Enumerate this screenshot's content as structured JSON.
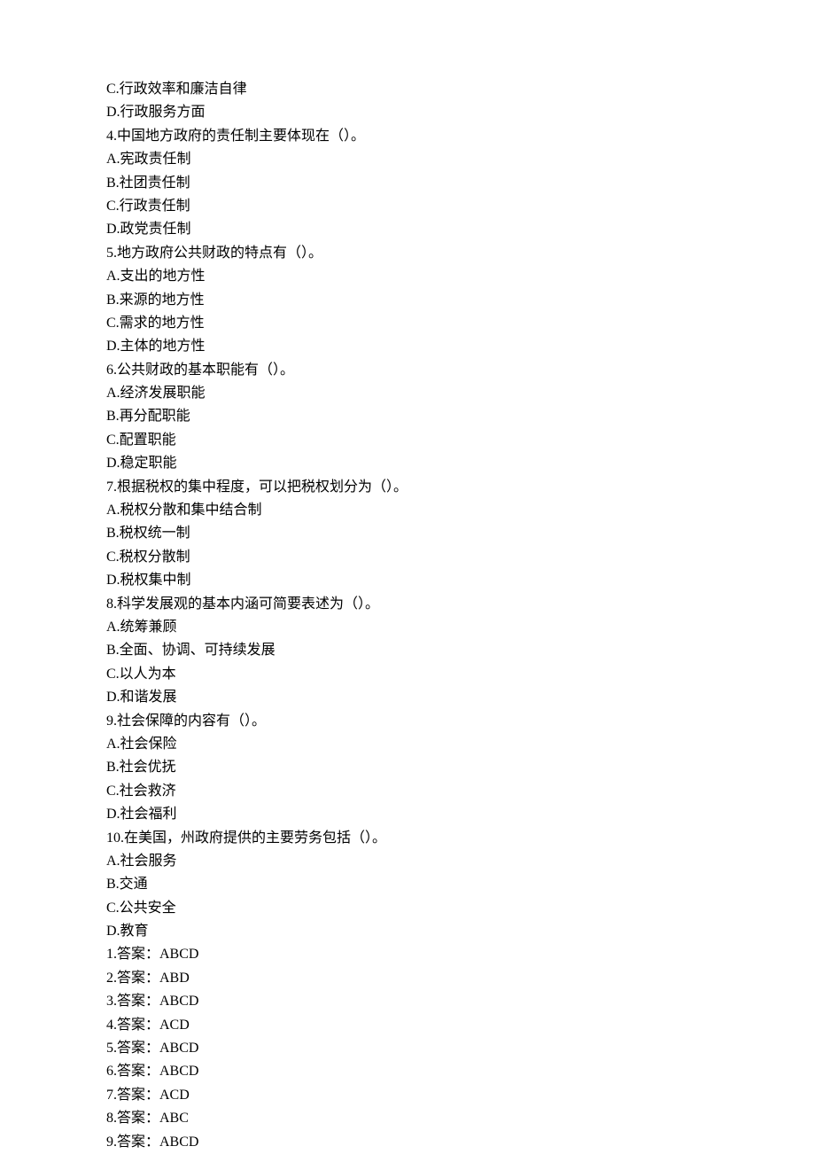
{
  "lines": [
    "C.行政效率和廉洁自律",
    "D.行政服务方面",
    "4.中国地方政府的责任制主要体现在（）。",
    "A.宪政责任制",
    "B.社团责任制",
    "C.行政责任制",
    "D.政党责任制",
    "5.地方政府公共财政的特点有（）。",
    "A.支出的地方性",
    "B.来源的地方性",
    "C.需求的地方性",
    "D.主体的地方性",
    "6.公共财政的基本职能有（）。",
    "A.经济发展职能",
    "B.再分配职能",
    "C.配置职能",
    "D.稳定职能",
    "7.根据税权的集中程度，可以把税权划分为（）。",
    "A.税权分散和集中结合制",
    "B.税权统一制",
    "C.税权分散制",
    "D.税权集中制",
    "8.科学发展观的基本内涵可简要表述为（）。",
    "A.统筹兼顾",
    "B.全面、协调、可持续发展",
    "C.以人为本",
    "D.和谐发展",
    "9.社会保障的内容有（）。",
    "A.社会保险",
    "B.社会优抚",
    "C.社会救济",
    "D.社会福利",
    "10.在美国，州政府提供的主要劳务包括（）。",
    "A.社会服务",
    "B.交通",
    "C.公共安全",
    "D.教育",
    "1.答案：ABCD",
    "2.答案：ABD",
    "3.答案：ABCD",
    "4.答案：ACD",
    "5.答案：ABCD",
    "6.答案：ABCD",
    "7.答案：ACD",
    "8.答案：ABC",
    "9.答案：ABCD"
  ]
}
